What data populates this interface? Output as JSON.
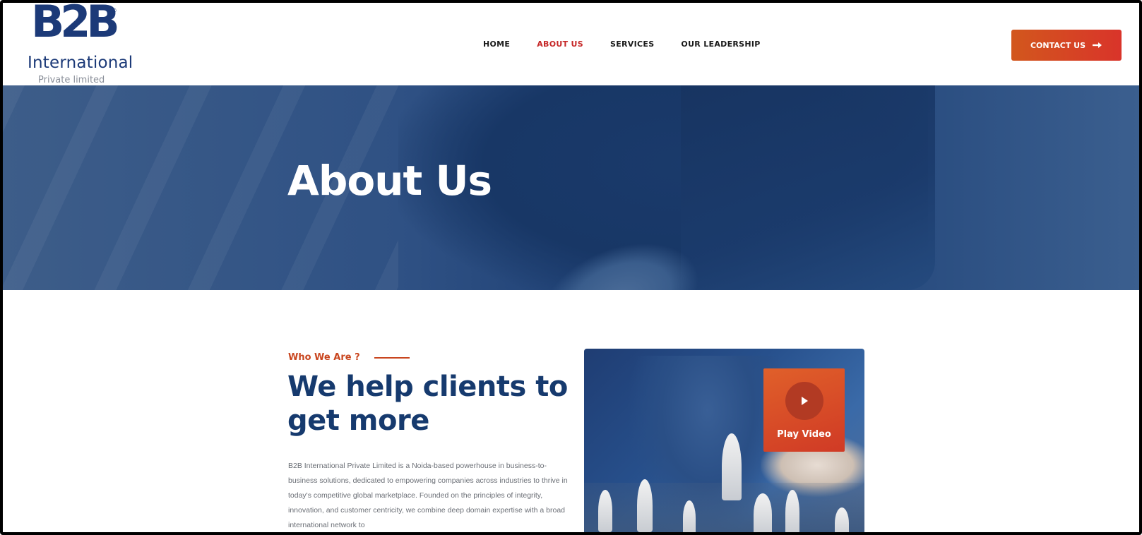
{
  "brand": {
    "logo_mark": "B2B",
    "logo_line1": "International",
    "logo_line2": "Private limited",
    "registered": "®"
  },
  "nav": {
    "items": [
      {
        "label": "HOME",
        "active": false
      },
      {
        "label": "ABOUT US",
        "active": true
      },
      {
        "label": "SERVICES",
        "active": false
      },
      {
        "label": "OUR LEADERSHIP",
        "active": false
      }
    ],
    "contact_label": "CONTACT US"
  },
  "hero": {
    "title": "About Us"
  },
  "about": {
    "eyebrow": "Who We Are ?",
    "headline": "We help clients to get more",
    "paragraph": "B2B International Private Limited is a Noida-based powerhouse in business-to-business solutions, dedicated to empowering companies across industries to thrive in today's competitive global marketplace. Founded on the principles of integrity, innovation, and customer centricity, we combine deep domain expertise with a broad international network to"
  },
  "video": {
    "play_label": "Play Video"
  },
  "colors": {
    "accent": "#c62828",
    "cta_start": "#d2571d",
    "cta_end": "#d9342a",
    "navy": "#163a6e",
    "hero_blue": "#2f5184"
  },
  "icons": {
    "contact": "arrow-right-icon",
    "video": "play-icon"
  }
}
